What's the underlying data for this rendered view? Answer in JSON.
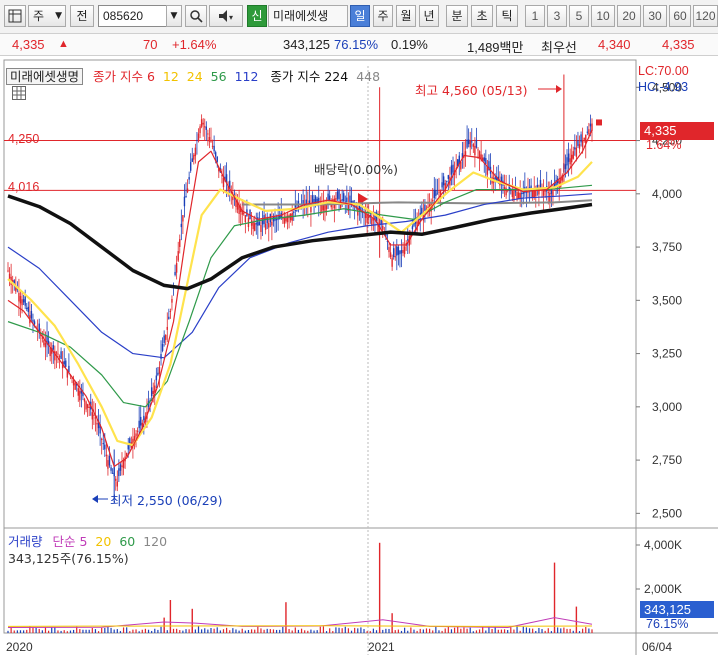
{
  "toolbar": {
    "menu_icon": "grid-menu-icon",
    "market_label": "주",
    "total_label": "전",
    "stock_code": "085620",
    "new_label": "신",
    "stock_name": "미래에셋생",
    "periods": [
      "일",
      "주",
      "월",
      "년",
      "분",
      "초",
      "틱"
    ],
    "active_period": "일",
    "counts": [
      "1",
      "3",
      "5",
      "10",
      "20",
      "30",
      "60",
      "120"
    ]
  },
  "quote": {
    "price": "4,335",
    "change": "70",
    "change_pct": "+1.64%",
    "volume": "343,125",
    "volume_ratio": "76.15%",
    "turnover": "0.19%",
    "amount": "1,489백만",
    "pref_label": "최우선",
    "ask": "4,340",
    "bid": "4,335"
  },
  "legend": {
    "title": "미래에셋생명",
    "ma_label": "종가 지수 6",
    "ma12": "12",
    "ma24": "24",
    "ma56": "56",
    "ma112": "112",
    "ma224_label": "종가 지수 224",
    "ma448": "448",
    "lc": "LC:70.00",
    "hc": "HC:-4.93"
  },
  "annotations": {
    "dividend": "배당락(0.00%)",
    "high": "최고 4,560 (05/13)",
    "low": "최저 2,550 (06/29)",
    "line1": "4,250",
    "line2": "4,016"
  },
  "price_tag": {
    "price": "4,335",
    "pct": "1.64%"
  },
  "volume_panel": {
    "title": "거래량",
    "ma_label": "단순 5",
    "ma20": "20",
    "ma60": "60",
    "ma120": "120",
    "current": "343,125주(76.15%)",
    "tag": "343,125",
    "tag_pct": "76.15%"
  },
  "colors": {
    "ma6": "#e0262b",
    "ma12": "#f2c200",
    "ma24": "#ffe34d",
    "ma56": "#2f9a4a",
    "ma112": "#2a3fc8",
    "ma224": "#111111",
    "ma448": "#888888"
  },
  "chart_data": {
    "type": "candlestick",
    "price_axis": [
      "4,500",
      "4,250",
      "4,000",
      "3,750",
      "3,500",
      "3,250",
      "3,000",
      "2,750",
      "2,500"
    ],
    "volume_axis": [
      "4,000K",
      "2,000K"
    ],
    "x_labels": [
      "2020",
      "2021",
      "06/04"
    ],
    "ylim": [
      2450,
      4600
    ],
    "price_path": [
      [
        0,
        3640
      ],
      [
        8,
        3520
      ],
      [
        16,
        3400
      ],
      [
        24,
        3300
      ],
      [
        32,
        3250
      ],
      [
        40,
        3150
      ],
      [
        48,
        3050
      ],
      [
        56,
        2950
      ],
      [
        62,
        2800
      ],
      [
        66,
        2700
      ],
      [
        70,
        2650
      ],
      [
        74,
        2750
      ],
      [
        80,
        2850
      ],
      [
        88,
        2950
      ],
      [
        96,
        3150
      ],
      [
        104,
        3450
      ],
      [
        112,
        3900
      ],
      [
        118,
        4150
      ],
      [
        124,
        4350
      ],
      [
        130,
        4250
      ],
      [
        136,
        4100
      ],
      [
        144,
        4000
      ],
      [
        152,
        3900
      ],
      [
        160,
        3850
      ],
      [
        170,
        3870
      ],
      [
        180,
        3900
      ],
      [
        190,
        3950
      ],
      [
        200,
        3950
      ],
      [
        210,
        3980
      ],
      [
        220,
        3950
      ],
      [
        230,
        3900
      ],
      [
        240,
        3850
      ],
      [
        246,
        3700
      ],
      [
        252,
        3720
      ],
      [
        260,
        3850
      ],
      [
        270,
        3950
      ],
      [
        280,
        4050
      ],
      [
        290,
        4150
      ],
      [
        296,
        4250
      ],
      [
        302,
        4200
      ],
      [
        310,
        4080
      ],
      [
        320,
        4020
      ],
      [
        330,
        4000
      ],
      [
        340,
        4030
      ],
      [
        348,
        4000
      ],
      [
        356,
        4100
      ],
      [
        362,
        4200
      ],
      [
        368,
        4250
      ],
      [
        374,
        4330
      ]
    ],
    "ma6": [
      [
        0,
        3500
      ],
      [
        10,
        3450
      ],
      [
        20,
        3350
      ],
      [
        30,
        3250
      ],
      [
        40,
        3150
      ],
      [
        50,
        3050
      ],
      [
        60,
        2900
      ],
      [
        68,
        2720
      ],
      [
        76,
        2760
      ],
      [
        86,
        2900
      ],
      [
        96,
        3100
      ],
      [
        106,
        3400
      ],
      [
        114,
        3800
      ],
      [
        122,
        4150
      ],
      [
        130,
        4200
      ],
      [
        140,
        4050
      ],
      [
        150,
        3920
      ],
      [
        160,
        3880
      ],
      [
        175,
        3900
      ],
      [
        190,
        3950
      ],
      [
        205,
        3970
      ],
      [
        220,
        3950
      ],
      [
        235,
        3880
      ],
      [
        245,
        3760
      ],
      [
        255,
        3760
      ],
      [
        265,
        3880
      ],
      [
        280,
        4020
      ],
      [
        292,
        4180
      ],
      [
        302,
        4170
      ],
      [
        315,
        4060
      ],
      [
        330,
        4010
      ],
      [
        345,
        4020
      ],
      [
        358,
        4100
      ],
      [
        368,
        4200
      ],
      [
        374,
        4300
      ]
    ],
    "ma24": [
      [
        0,
        3600
      ],
      [
        15,
        3500
      ],
      [
        30,
        3380
      ],
      [
        45,
        3200
      ],
      [
        60,
        3000
      ],
      [
        70,
        2840
      ],
      [
        80,
        2820
      ],
      [
        92,
        2950
      ],
      [
        104,
        3200
      ],
      [
        114,
        3550
      ],
      [
        124,
        3900
      ],
      [
        136,
        4020
      ],
      [
        150,
        3970
      ],
      [
        165,
        3920
      ],
      [
        185,
        3930
      ],
      [
        205,
        3960
      ],
      [
        225,
        3950
      ],
      [
        240,
        3880
      ],
      [
        252,
        3820
      ],
      [
        265,
        3900
      ],
      [
        282,
        4010
      ],
      [
        298,
        4100
      ],
      [
        312,
        4060
      ],
      [
        330,
        4020
      ],
      [
        350,
        4030
      ],
      [
        365,
        4080
      ],
      [
        374,
        4150
      ]
    ],
    "ma56": [
      [
        0,
        3400
      ],
      [
        20,
        3350
      ],
      [
        40,
        3280
      ],
      [
        60,
        3150
      ],
      [
        74,
        3020
      ],
      [
        88,
        3000
      ],
      [
        102,
        3120
      ],
      [
        116,
        3400
      ],
      [
        130,
        3700
      ],
      [
        145,
        3850
      ],
      [
        165,
        3880
      ],
      [
        190,
        3900
      ],
      [
        215,
        3930
      ],
      [
        240,
        3900
      ],
      [
        260,
        3880
      ],
      [
        280,
        3960
      ],
      [
        300,
        4020
      ],
      [
        320,
        4020
      ],
      [
        345,
        4020
      ],
      [
        374,
        4040
      ]
    ],
    "ma112": [
      [
        0,
        3750
      ],
      [
        20,
        3650
      ],
      [
        40,
        3500
      ],
      [
        60,
        3350
      ],
      [
        80,
        3250
      ],
      [
        100,
        3230
      ],
      [
        118,
        3350
      ],
      [
        135,
        3560
      ],
      [
        155,
        3700
      ],
      [
        180,
        3770
      ],
      [
        205,
        3820
      ],
      [
        230,
        3850
      ],
      [
        255,
        3870
      ],
      [
        280,
        3900
      ],
      [
        305,
        3950
      ],
      [
        330,
        3980
      ],
      [
        355,
        3990
      ],
      [
        374,
        4000
      ]
    ],
    "ma224": [
      [
        0,
        3990
      ],
      [
        20,
        3940
      ],
      [
        40,
        3860
      ],
      [
        60,
        3750
      ],
      [
        80,
        3640
      ],
      [
        100,
        3570
      ],
      [
        115,
        3555
      ],
      [
        130,
        3600
      ],
      [
        150,
        3700
      ],
      [
        170,
        3750
      ],
      [
        195,
        3780
      ],
      [
        220,
        3800
      ],
      [
        245,
        3820
      ],
      [
        265,
        3810
      ],
      [
        285,
        3840
      ],
      [
        310,
        3880
      ],
      [
        335,
        3910
      ],
      [
        355,
        3930
      ],
      [
        374,
        3950
      ]
    ],
    "ma448": [
      [
        150,
        3950
      ],
      [
        200,
        3950
      ],
      [
        250,
        3960
      ],
      [
        300,
        3955
      ],
      [
        350,
        3960
      ],
      [
        374,
        3970
      ]
    ],
    "volume_spikes": [
      [
        100,
        700
      ],
      [
        104,
        1500
      ],
      [
        118,
        1100
      ],
      [
        178,
        1400
      ],
      [
        238,
        4100
      ],
      [
        246,
        900
      ],
      [
        350,
        3200
      ],
      [
        364,
        1200
      ]
    ],
    "volume_max": 4500
  }
}
